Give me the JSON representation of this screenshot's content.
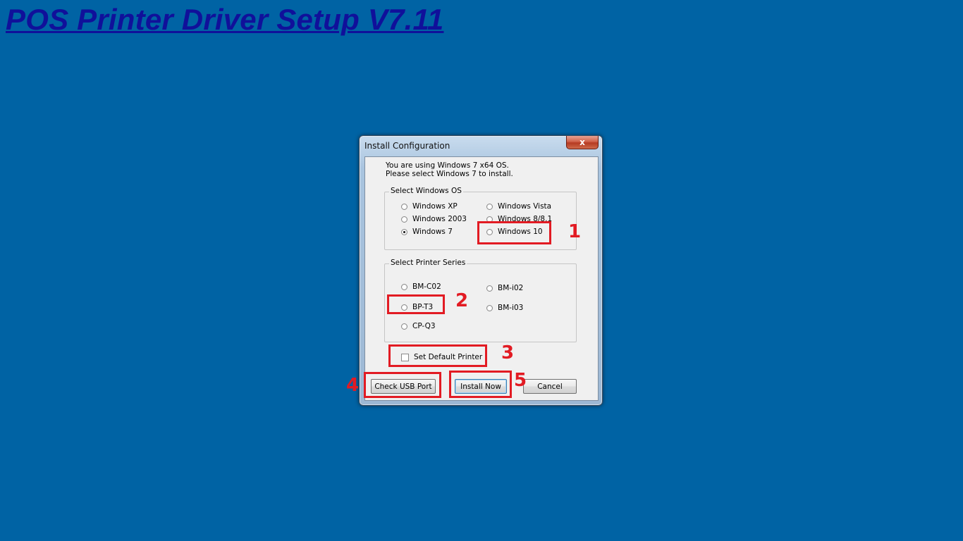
{
  "page": {
    "title": "POS Printer Driver Setup V7.11"
  },
  "window": {
    "title": "Install Configuration",
    "close_glyph": "x",
    "info_line1": "You are using Windows 7 x64 OS.",
    "info_line2": "Please select Windows 7 to install."
  },
  "os_group": {
    "label": "Select Windows OS",
    "options": [
      {
        "label": "Windows XP",
        "checked": false
      },
      {
        "label": "Windows Vista",
        "checked": false
      },
      {
        "label": "Windows 2003",
        "checked": false
      },
      {
        "label": "Windows 8/8.1",
        "checked": false
      },
      {
        "label": "Windows 7",
        "checked": true
      },
      {
        "label": "Windows 10",
        "checked": false
      }
    ]
  },
  "printer_group": {
    "label": "Select Printer Series",
    "options": [
      {
        "label": "BM-C02",
        "checked": false
      },
      {
        "label": "BM-i02",
        "checked": false
      },
      {
        "label": "BP-T3",
        "checked": false
      },
      {
        "label": "BM-i03",
        "checked": false
      },
      {
        "label": "CP-Q3",
        "checked": false
      }
    ]
  },
  "default_printer": {
    "label": "Set Default Printer",
    "checked": false
  },
  "buttons": {
    "check_usb": "Check USB Port",
    "install_now": "Install Now",
    "cancel": "Cancel"
  },
  "annotations": {
    "color": "#e21b23",
    "numbers": [
      "1",
      "2",
      "3",
      "4",
      "5"
    ]
  }
}
